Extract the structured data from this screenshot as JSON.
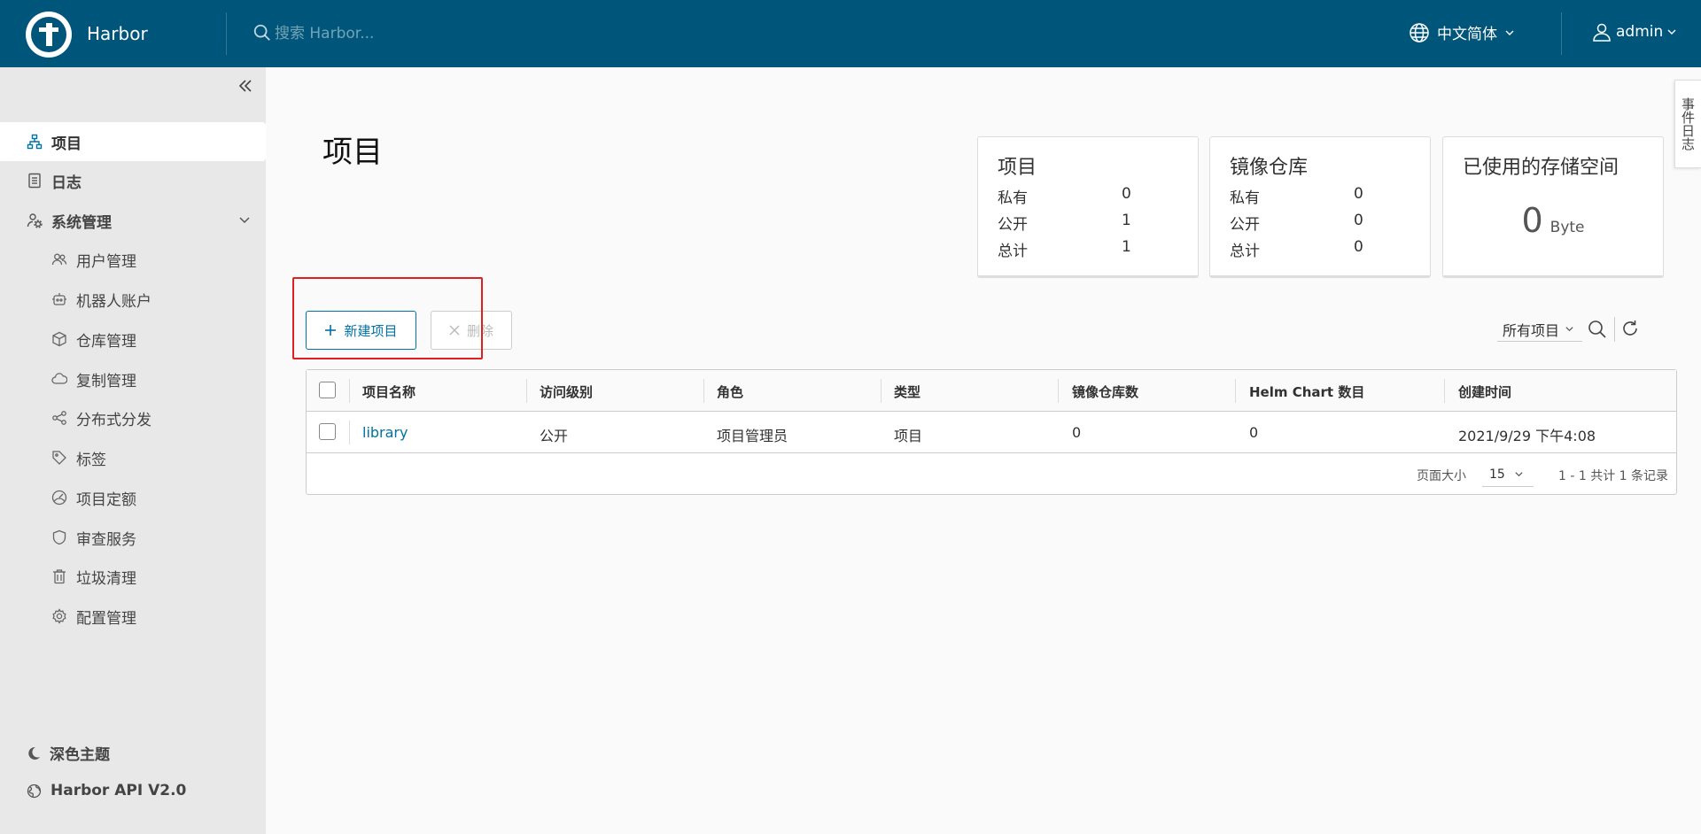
{
  "header": {
    "brand": "Harbor",
    "search_placeholder": "搜索 Harbor...",
    "language": "中文简体",
    "user": "admin"
  },
  "sidebar": {
    "items": [
      {
        "label": "项目",
        "icon": "project-tree-icon"
      },
      {
        "label": "日志",
        "icon": "log-icon"
      },
      {
        "label": "系统管理",
        "icon": "system-admin-icon"
      }
    ],
    "sub_items": [
      {
        "label": "用户管理",
        "icon": "users-icon"
      },
      {
        "label": "机器人账户",
        "icon": "robot-icon"
      },
      {
        "label": "仓库管理",
        "icon": "cube-icon"
      },
      {
        "label": "复制管理",
        "icon": "cloud-sync-icon"
      },
      {
        "label": "分布式分发",
        "icon": "share-icon"
      },
      {
        "label": "标签",
        "icon": "tag-icon"
      },
      {
        "label": "项目定额",
        "icon": "quota-icon"
      },
      {
        "label": "审查服务",
        "icon": "shield-icon"
      },
      {
        "label": "垃圾清理",
        "icon": "trash-icon"
      },
      {
        "label": "配置管理",
        "icon": "gear-icon"
      }
    ],
    "theme": "深色主题",
    "api": "Harbor API V2.0"
  },
  "event_tab": "事件日志",
  "page": {
    "title": "项目"
  },
  "cards": {
    "projects": {
      "title": "项目",
      "rows": [
        {
          "label": "私有",
          "value": "0"
        },
        {
          "label": "公开",
          "value": "1"
        },
        {
          "label": "总计",
          "value": "1"
        }
      ]
    },
    "repos": {
      "title": "镜像仓库",
      "rows": [
        {
          "label": "私有",
          "value": "0"
        },
        {
          "label": "公开",
          "value": "0"
        },
        {
          "label": "总计",
          "value": "0"
        }
      ]
    },
    "storage": {
      "title": "已使用的存储空间",
      "value": "0",
      "unit": "Byte"
    }
  },
  "toolbar": {
    "new_project": "新建项目",
    "delete": "删除",
    "filter": "所有项目"
  },
  "table": {
    "headers": [
      "项目名称",
      "访问级别",
      "角色",
      "类型",
      "镜像仓库数",
      "Helm Chart 数目",
      "创建时间"
    ],
    "rows": [
      [
        "library",
        "公开",
        "项目管理员",
        "项目",
        "0",
        "0",
        "2021/9/29 下午4:08"
      ]
    ],
    "footer": {
      "page_size_label": "页面大小",
      "page_size": "15",
      "summary": "1 - 1 共计 1 条记录"
    }
  }
}
